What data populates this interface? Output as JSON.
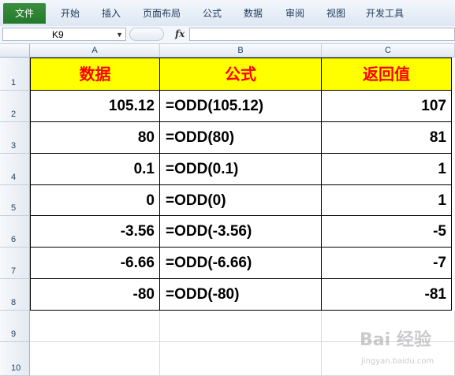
{
  "ribbon": {
    "tabs": [
      "文件",
      "开始",
      "插入",
      "页面布局",
      "公式",
      "数据",
      "审阅",
      "视图",
      "开发工具"
    ]
  },
  "formula_bar": {
    "name_box": "K9",
    "fx_label": "fx",
    "formula": ""
  },
  "columns": [
    "A",
    "B",
    "C"
  ],
  "rows": [
    "1",
    "2",
    "3",
    "4",
    "5",
    "6",
    "7",
    "8",
    "9",
    "10"
  ],
  "table": {
    "headers": [
      "数据",
      "公式",
      "返回值"
    ],
    "data": [
      [
        "105.12",
        "=ODD(105.12)",
        "107"
      ],
      [
        "80",
        "=ODD(80)",
        "81"
      ],
      [
        "0.1",
        "=ODD(0.1)",
        "1"
      ],
      [
        "0",
        "=ODD(0)",
        "1"
      ],
      [
        "-3.56",
        "=ODD(-3.56)",
        "-5"
      ],
      [
        "-6.66",
        "=ODD(-6.66)",
        "-7"
      ],
      [
        "-80",
        "=ODD(-80)",
        "-81"
      ]
    ]
  },
  "colors": {
    "header_fill": "#ffff00",
    "header_text": "#ff0000",
    "file_tab": "#2e8436"
  },
  "watermark": {
    "logo": "Bai 经验",
    "url": "jingyan.baidu.com"
  }
}
